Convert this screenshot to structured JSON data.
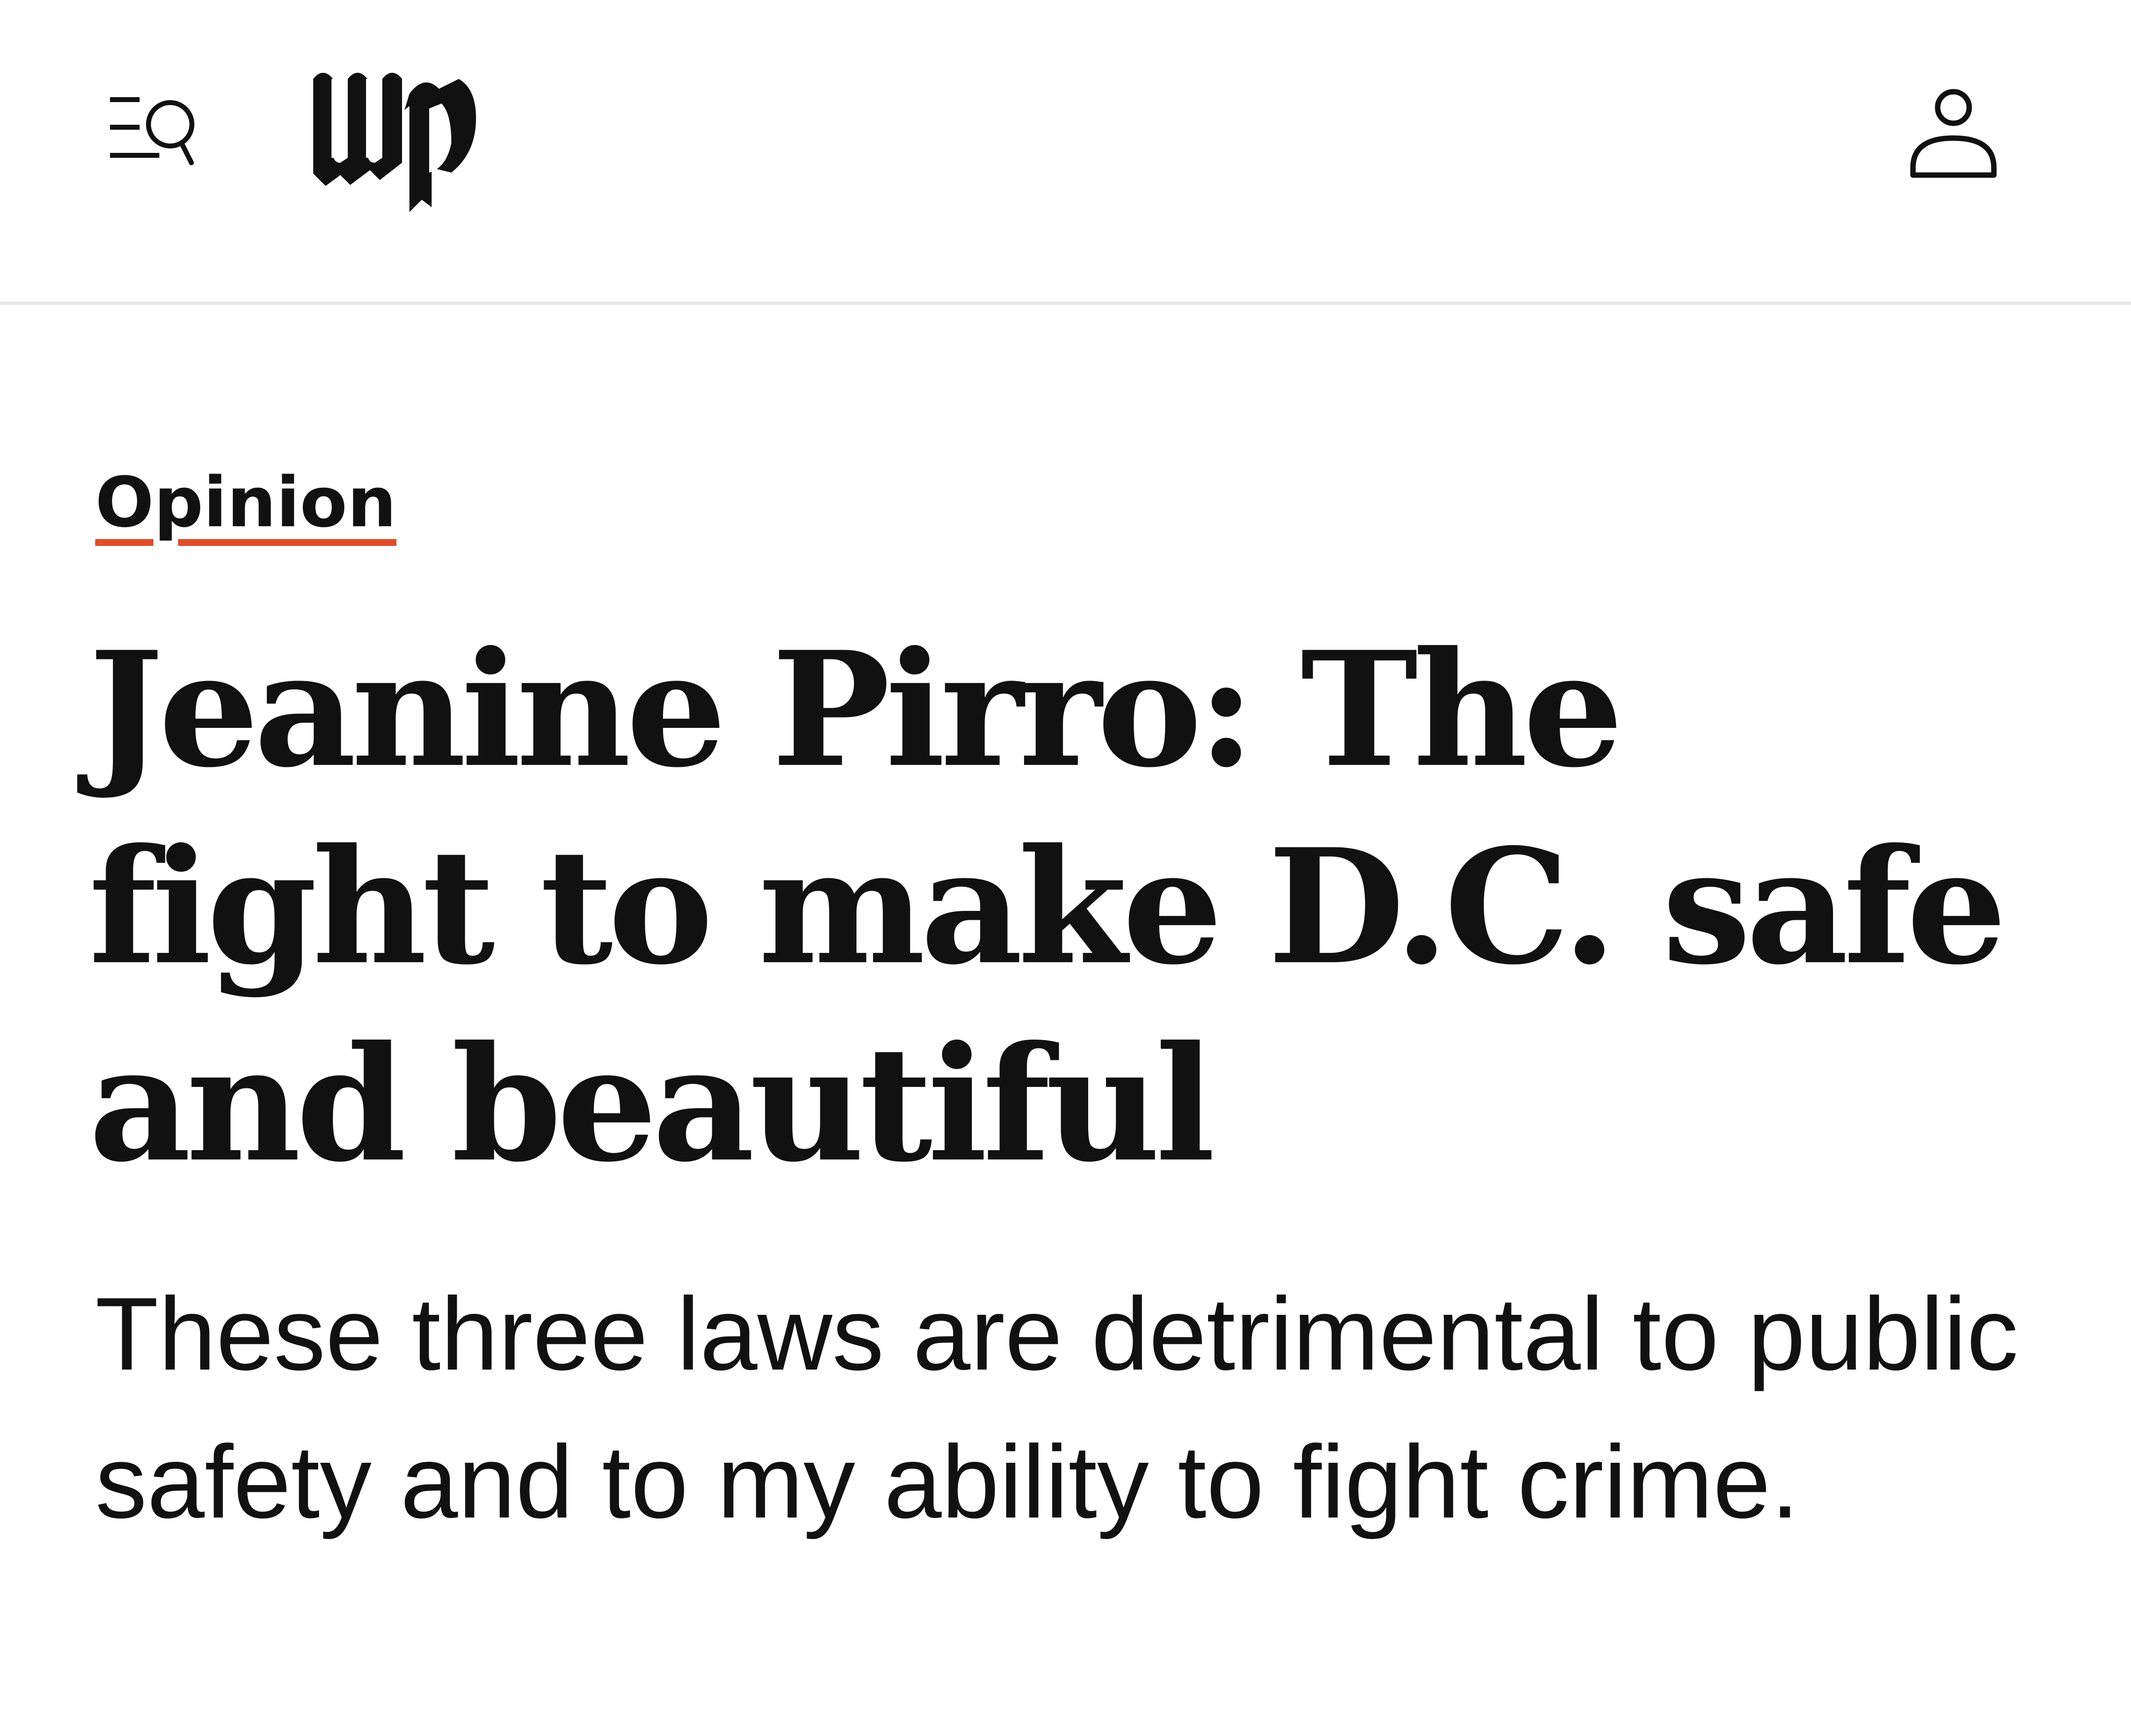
{
  "header": {
    "menu_icon": "menu-search-icon",
    "logo_icon": "wp-logo",
    "profile_icon": "user-icon"
  },
  "article": {
    "section_label": "Opinion",
    "headline": "Jeanine Pirro: The fight to make D.C. safe and beautiful",
    "subheadline": "These three laws are detrimental to public safety and to my ability to fight crime."
  },
  "colors": {
    "text": "#111111",
    "accent_underline": "#e04e2b",
    "divider": "#e6e6e6",
    "background": "#ffffff"
  }
}
